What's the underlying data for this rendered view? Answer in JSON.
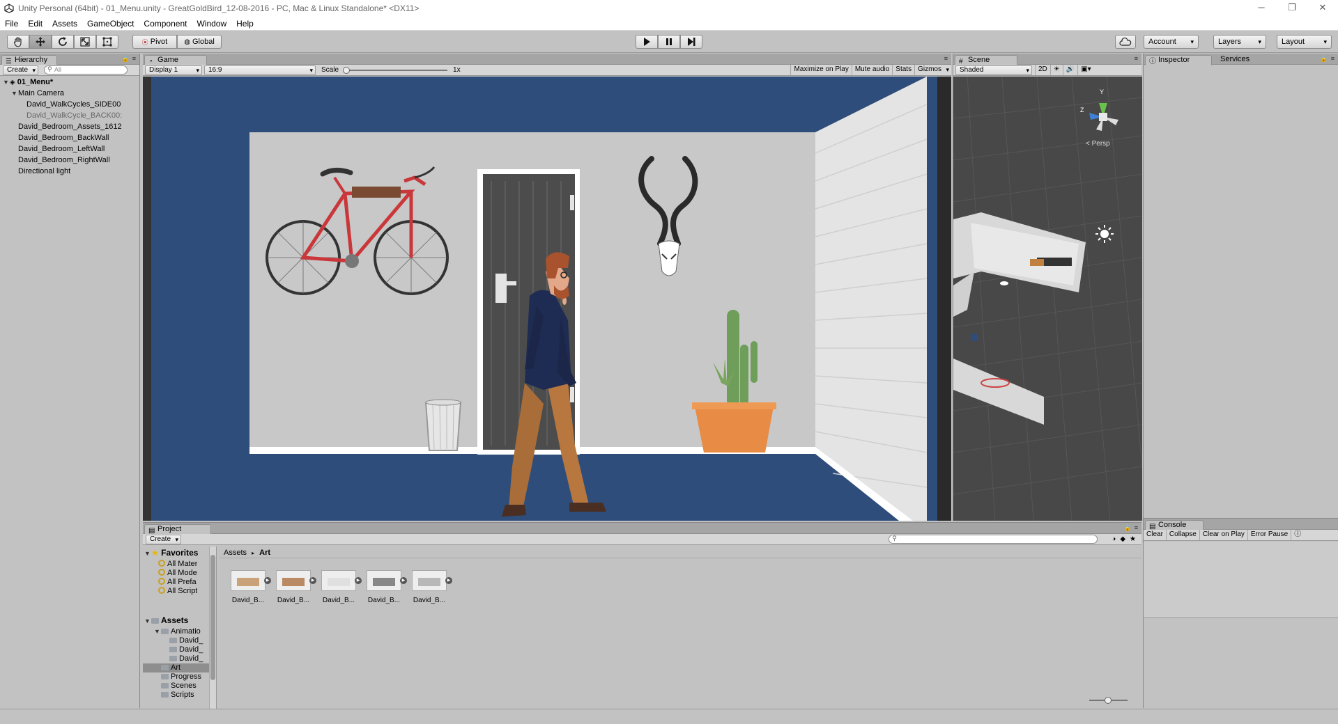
{
  "window": {
    "title": "Unity Personal (64bit) - 01_Menu.unity - GreatGoldBird_12-08-2016 - PC, Mac & Linux Standalone* <DX11>",
    "buttons": [
      "─",
      "❐",
      "✕"
    ]
  },
  "menu": [
    "File",
    "Edit",
    "Assets",
    "GameObject",
    "Component",
    "Window",
    "Help"
  ],
  "toolbar": {
    "tools": [
      "hand-tool",
      "move-tool",
      "rotate-tool",
      "scale-tool",
      "rect-tool"
    ],
    "pivot": "Pivot",
    "global": "Global",
    "account": "Account",
    "layers": "Layers",
    "layout": "Layout"
  },
  "hierarchy": {
    "tab": "Hierarchy",
    "create": "Create",
    "search_placeholder": "All",
    "scene": "01_Menu*",
    "items": [
      {
        "label": "Main Camera",
        "indent": 1,
        "expanded": true,
        "dim": false
      },
      {
        "label": "David_WalkCycles_SIDE00",
        "indent": 2,
        "expanded": null,
        "dim": false
      },
      {
        "label": "David_WalkCycle_BACK00:",
        "indent": 2,
        "expanded": null,
        "dim": true
      },
      {
        "label": "David_Bedroom_Assets_1612",
        "indent": 1,
        "expanded": null,
        "dim": false
      },
      {
        "label": "David_Bedroom_BackWall",
        "indent": 1,
        "expanded": null,
        "dim": false
      },
      {
        "label": "David_Bedroom_LeftWall",
        "indent": 1,
        "expanded": null,
        "dim": false
      },
      {
        "label": "David_Bedroom_RightWall",
        "indent": 1,
        "expanded": null,
        "dim": false
      },
      {
        "label": "Directional light",
        "indent": 1,
        "expanded": null,
        "dim": false
      }
    ]
  },
  "game": {
    "tab": "Game",
    "display": "Display 1",
    "aspect": "16:9",
    "scale_label": "Scale",
    "scale_value": "1x",
    "buttons": [
      "Maximize on Play",
      "Mute audio",
      "Stats",
      "Gizmos"
    ]
  },
  "scene": {
    "tab": "Scene",
    "shading": "Shaded",
    "mode2d": "2D",
    "persp": "< Persp",
    "axes": {
      "y": "Y",
      "z": "Z"
    }
  },
  "inspector": {
    "tab": "Inspector",
    "services": "Services"
  },
  "project": {
    "tab": "Project",
    "create": "Create",
    "favorites": "Favorites",
    "favorite_items": [
      "All Mater",
      "All Mode",
      "All Prefa",
      "All Script"
    ],
    "assets": "Assets",
    "asset_tree": [
      {
        "label": "Animatio",
        "indent": 1,
        "expanded": true,
        "selected": false
      },
      {
        "label": "David_",
        "indent": 2,
        "expanded": null,
        "selected": false
      },
      {
        "label": "David_",
        "indent": 2,
        "expanded": null,
        "selected": false
      },
      {
        "label": "David_",
        "indent": 2,
        "expanded": null,
        "selected": false
      },
      {
        "label": "Art",
        "indent": 1,
        "expanded": null,
        "selected": true
      },
      {
        "label": "Progress",
        "indent": 1,
        "expanded": null,
        "selected": false
      },
      {
        "label": "Scenes",
        "indent": 1,
        "expanded": null,
        "selected": false
      },
      {
        "label": "Scripts",
        "indent": 1,
        "expanded": null,
        "selected": false
      }
    ],
    "breadcrumb": [
      "Assets",
      "Art"
    ],
    "assets_grid": [
      "David_B...",
      "David_B...",
      "David_B...",
      "David_B...",
      "David_B..."
    ]
  },
  "console": {
    "tab": "Console",
    "buttons": [
      "Clear",
      "Collapse",
      "Clear on Play",
      "Error Pause"
    ]
  },
  "colors": {
    "editor_bg": "#c2c2c2",
    "game_floor": "#2f4d7a",
    "back_wall": "#c8c8c8",
    "scene_bg": "#484848",
    "bike_red": "#c9373a",
    "pot_orange": "#e78b45",
    "cactus_green": "#6e9e59"
  }
}
